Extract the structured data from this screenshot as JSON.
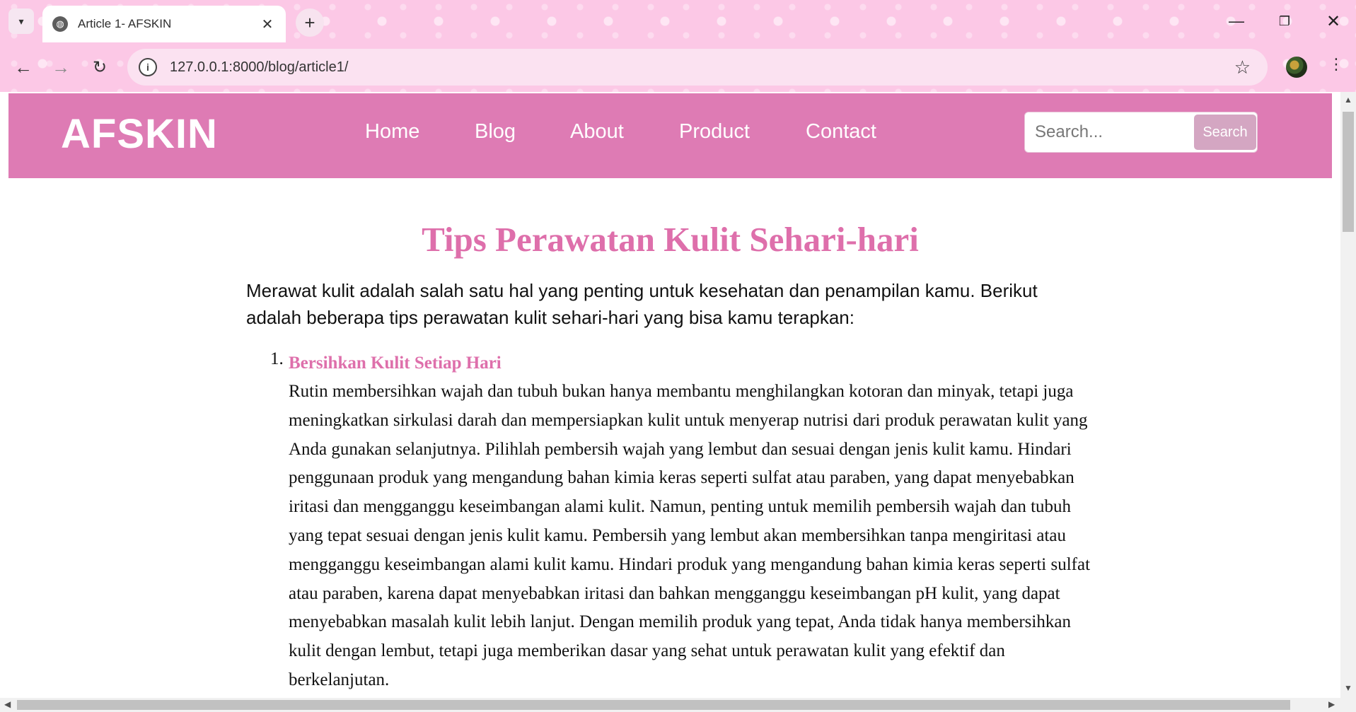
{
  "browser": {
    "tab_title": "Article 1- AFSKIN",
    "tab_close": "✕",
    "new_tab": "+",
    "url": "127.0.0.1:8000/blog/article1/",
    "icons": {
      "tab_search": "chevron-down-icon",
      "favicon": "globe-icon",
      "back": "arrow-left-icon",
      "forward": "arrow-right-icon",
      "reload": "reload-icon",
      "info": "info-icon",
      "bookmark": "star-icon",
      "menu": "kebab-menu-icon"
    }
  },
  "site": {
    "brand": "AFSKIN",
    "nav": [
      "Home",
      "Blog",
      "About",
      "Product",
      "Contact"
    ],
    "search": {
      "placeholder": "Search...",
      "button": "Search"
    },
    "colors": {
      "header": "#de7bb4",
      "accent": "#de6fab",
      "search_button": "#d4a6c2"
    }
  },
  "article": {
    "title": "Tips Perawatan Kulit Sehari-hari",
    "intro": "Merawat kulit adalah salah satu hal yang penting untuk kesehatan dan penampilan kamu. Berikut adalah beberapa tips perawatan kulit sehari-hari yang bisa kamu terapkan:",
    "tips": [
      {
        "number": "1.",
        "heading": "Bersihkan Kulit Setiap Hari",
        "text": "Rutin membersihkan wajah dan tubuh bukan hanya membantu menghilangkan kotoran dan minyak, tetapi juga meningkatkan sirkulasi darah dan mempersiapkan kulit untuk menyerap nutrisi dari produk perawatan kulit yang Anda gunakan selanjutnya. Pilihlah pembersih wajah yang lembut dan sesuai dengan jenis kulit kamu. Hindari penggunaan produk yang mengandung bahan kimia keras seperti sulfat atau paraben, yang dapat menyebabkan iritasi dan mengganggu keseimbangan alami kulit. Namun, penting untuk memilih pembersih wajah dan tubuh yang tepat sesuai dengan jenis kulit kamu. Pembersih yang lembut akan membersihkan tanpa mengiritasi atau mengganggu keseimbangan alami kulit kamu. Hindari produk yang mengandung bahan kimia keras seperti sulfat atau paraben, karena dapat menyebabkan iritasi dan bahkan mengganggu keseimbangan pH kulit, yang dapat menyebabkan masalah kulit lebih lanjut. Dengan memilih produk yang tepat, Anda tidak hanya membersihkan kulit dengan lembut, tetapi juga memberikan dasar yang sehat untuk perawatan kulit yang efektif dan berkelanjutan."
      }
    ]
  }
}
